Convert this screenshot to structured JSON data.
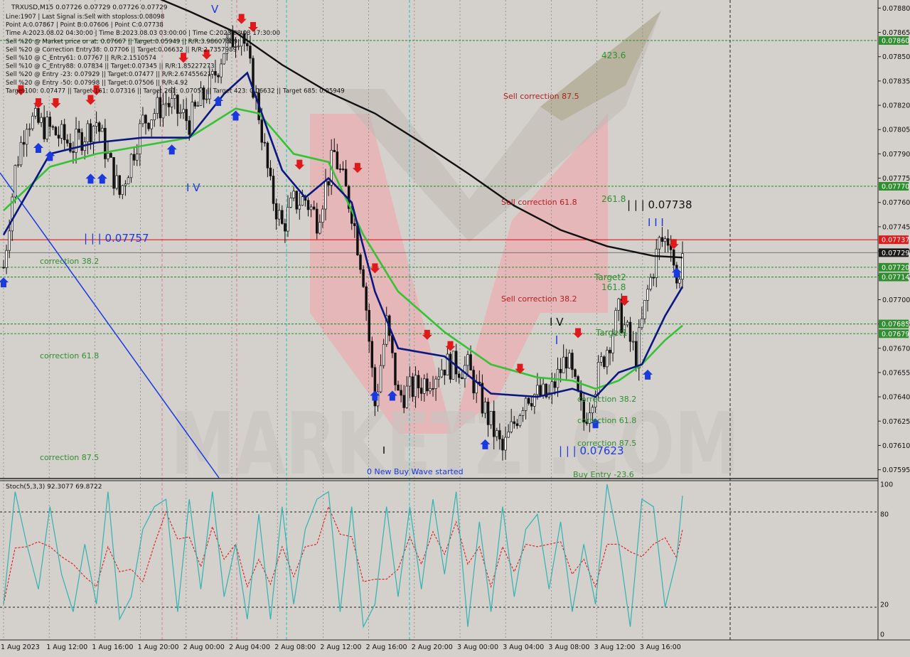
{
  "header": {
    "symbol_line": "TRXUSD,M15  0.07726 0.07729 0.07726 0.07729",
    "info_lines": [
      "Line:1907 | Last Signal is:Sell with stoploss:0.08098",
      "Point A:0.07867 | Point B:0.07606 | Point C:0.07738",
      "Time A:2023.08.02 04:30:00 | Time B:2023.08.03 03:00:00 | Time C:2023.08.03 17:30:00",
      "Sell %20 @ Market price or at: 0.07667 || Target:0.05949 || R/R:3.98607889",
      "Sell %20 @ Correction Entry38: 0.07706 || Target:0.06632 || R/R:2.7357989",
      "Sell %10 @ C_Entry61: 0.07767 || R/R:2.1510574",
      "Sell %10 @ C_Entry88: 0.07834 || Target:0.07345 || R/R:1.85227273",
      "Sell %20 @ Entry -23: 0.07929 || Target:0.07477 || R/R:2.67455621",
      "Sell %20 @ Entry -50: 0.07998 || Target:0.07506 || R/R:4.92",
      "Target100: 0.07477 || Target 161: 0.07316 || Target 261: 0.07055 || Target 423: 0.06632 || Target 685: 0.05949"
    ]
  },
  "annotations": {
    "fib_423": "423.6",
    "fib_261": "261.8",
    "fib_161": "161.8",
    "target2": "Target2",
    "target1": "Target1",
    "sell_corr_875": "Sell correction 87.5",
    "sell_corr_618": "Sell correction 61.8",
    "sell_corr_382": "Sell correction 38.2",
    "corr_382_left": "correction 38.2",
    "corr_618_left": "correction 61.8",
    "corr_875_left": "correction 87.5",
    "corr_382_right": "correction 38.2",
    "corr_618_right": "correction 61.8",
    "corr_875_right": "correction 87.5",
    "buy_entry": "Buy Entry -23.6",
    "new_buy_wave": "0 New Buy Wave started",
    "wave_label_07757": "| | | 0.07757",
    "wave_label_07738": "| | | 0.07738",
    "wave_label_07623": "| | | 0.07623",
    "wave_v": "V",
    "wave_iv_left": "I V",
    "wave_iv_right": "I V",
    "wave_iii": "I I I",
    "watermark": "MARKETZI.COM"
  },
  "price_axis": {
    "ticks": [
      "0.07880",
      "0.07865",
      "0.07850",
      "0.07835",
      "0.07820",
      "0.07805",
      "0.07790",
      "0.07775",
      "0.07760",
      "0.07745",
      "0.07730",
      "0.07715",
      "0.07700",
      "0.07685",
      "0.07670",
      "0.07655",
      "0.07640",
      "0.07625",
      "0.07610",
      "0.07595"
    ],
    "badges": [
      {
        "text": "0.07860",
        "color": "#2f8f2f"
      },
      {
        "text": "0.07770",
        "color": "#2f8f2f"
      },
      {
        "text": "0.07737",
        "color": "#e01a1a"
      },
      {
        "text": "0.07729",
        "color": "#1a1a1a"
      },
      {
        "text": "0.07720",
        "color": "#2f8f2f"
      },
      {
        "text": "0.07714",
        "color": "#2f8f2f"
      },
      {
        "text": "0.07685",
        "color": "#2f8f2f"
      },
      {
        "text": "0.07679",
        "color": "#2f8f2f"
      }
    ]
  },
  "time_axis": {
    "labels": [
      "1 Aug 2023",
      "1 Aug 12:00",
      "1 Aug 16:00",
      "1 Aug 20:00",
      "2 Aug 00:00",
      "2 Aug 04:00",
      "2 Aug 08:00",
      "2 Aug 12:00",
      "2 Aug 16:00",
      "2 Aug 20:00",
      "3 Aug 00:00",
      "3 Aug 04:00",
      "3 Aug 08:00",
      "3 Aug 12:00",
      "3 Aug 16:00"
    ]
  },
  "stoch": {
    "title": "Stoch(5,3,3) 92.3077 69.8722",
    "levels": [
      "100",
      "80",
      "20",
      "0"
    ],
    "main": 92.3077,
    "signal": 69.8722
  },
  "colors": {
    "background": "#d4d0cb",
    "grid": "#8a8a8a",
    "level_green": "#2f8f2f",
    "ema_green": "#35c235",
    "ema_navy": "#0b1780",
    "ma_black": "#111111",
    "sell_arrow": "#e01a1a",
    "buy_arrow": "#1a3ae0",
    "resistance_red": "#e01a1a",
    "watermark_pink": "#e8b3b6"
  },
  "chart_data": {
    "type": "candlestick",
    "title": "TRXUSD,M15",
    "ylim": [
      0.0759,
      0.07885
    ],
    "price_levels": {
      "fib_423_6": 0.0786,
      "fib_261_8": 0.0777,
      "point_c_resistance": 0.07737,
      "current_price": 0.07729,
      "target2": 0.0772,
      "fib_161_8": 0.07714,
      "target1": 0.07685,
      "target1_low": 0.07679
    },
    "points": {
      "A": {
        "time": "2023.08.02 04:30:00",
        "price": 0.07867
      },
      "B": {
        "time": "2023.08.03 03:00:00",
        "price": 0.07606
      },
      "C": {
        "time": "2023.08.03 17:30:00",
        "price": 0.07738
      }
    },
    "close_path": [
      {
        "t": "1 Aug 08:00",
        "p": 0.0772
      },
      {
        "t": "1 Aug 09:00",
        "p": 0.0778
      },
      {
        "t": "1 Aug 10:00",
        "p": 0.07812
      },
      {
        "t": "1 Aug 12:00",
        "p": 0.07805
      },
      {
        "t": "1 Aug 14:00",
        "p": 0.07795
      },
      {
        "t": "1 Aug 16:00",
        "p": 0.0781
      },
      {
        "t": "1 Aug 18:00",
        "p": 0.07765
      },
      {
        "t": "1 Aug 20:00",
        "p": 0.0781
      },
      {
        "t": "1 Aug 22:00",
        "p": 0.07822
      },
      {
        "t": "2 Aug 00:00",
        "p": 0.0781
      },
      {
        "t": "2 Aug 02:00",
        "p": 0.07835
      },
      {
        "t": "2 Aug 03:00",
        "p": 0.07855
      },
      {
        "t": "2 Aug 04:30",
        "p": 0.07867
      },
      {
        "t": "2 Aug 06:00",
        "p": 0.07815
      },
      {
        "t": "2 Aug 07:00",
        "p": 0.07768
      },
      {
        "t": "2 Aug 08:00",
        "p": 0.07745
      },
      {
        "t": "2 Aug 09:00",
        "p": 0.0776
      },
      {
        "t": "2 Aug 10:00",
        "p": 0.07762
      },
      {
        "t": "2 Aug 11:00",
        "p": 0.0775
      },
      {
        "t": "2 Aug 12:30",
        "p": 0.0779
      },
      {
        "t": "2 Aug 14:00",
        "p": 0.07755
      },
      {
        "t": "2 Aug 15:00",
        "p": 0.07715
      },
      {
        "t": "2 Aug 16:00",
        "p": 0.07635
      },
      {
        "t": "2 Aug 17:00",
        "p": 0.07685
      },
      {
        "t": "2 Aug 18:00",
        "p": 0.0764
      },
      {
        "t": "2 Aug 20:00",
        "p": 0.07648
      },
      {
        "t": "2 Aug 22:00",
        "p": 0.0766
      },
      {
        "t": "3 Aug 00:00",
        "p": 0.07658
      },
      {
        "t": "3 Aug 01:00",
        "p": 0.0764
      },
      {
        "t": "3 Aug 03:00",
        "p": 0.07606
      },
      {
        "t": "3 Aug 05:00",
        "p": 0.07642
      },
      {
        "t": "3 Aug 07:00",
        "p": 0.0764
      },
      {
        "t": "3 Aug 08:30",
        "p": 0.07665
      },
      {
        "t": "3 Aug 10:00",
        "p": 0.07625
      },
      {
        "t": "3 Aug 11:30",
        "p": 0.0766
      },
      {
        "t": "3 Aug 13:00",
        "p": 0.07692
      },
      {
        "t": "3 Aug 14:30",
        "p": 0.07665
      },
      {
        "t": "3 Aug 15:30",
        "p": 0.07705
      },
      {
        "t": "3 Aug 16:30",
        "p": 0.07735
      },
      {
        "t": "3 Aug 17:30",
        "p": 0.07738
      },
      {
        "t": "3 Aug 18:00",
        "p": 0.07708
      },
      {
        "t": "3 Aug 18:30",
        "p": 0.07729
      }
    ],
    "ema_fast": [
      {
        "t": "1 Aug 08:00",
        "p": 0.0774
      },
      {
        "t": "1 Aug 12:00",
        "p": 0.0779
      },
      {
        "t": "1 Aug 16:00",
        "p": 0.07797
      },
      {
        "t": "1 Aug 20:00",
        "p": 0.078
      },
      {
        "t": "2 Aug 00:00",
        "p": 0.078
      },
      {
        "t": "2 Aug 03:00",
        "p": 0.07827
      },
      {
        "t": "2 Aug 05:00",
        "p": 0.0784
      },
      {
        "t": "2 Aug 08:00",
        "p": 0.0778
      },
      {
        "t": "2 Aug 10:00",
        "p": 0.07763
      },
      {
        "t": "2 Aug 12:00",
        "p": 0.07775
      },
      {
        "t": "2 Aug 14:00",
        "p": 0.0776
      },
      {
        "t": "2 Aug 16:00",
        "p": 0.07705
      },
      {
        "t": "2 Aug 18:00",
        "p": 0.0767
      },
      {
        "t": "2 Aug 22:00",
        "p": 0.07665
      },
      {
        "t": "3 Aug 02:00",
        "p": 0.07642
      },
      {
        "t": "3 Aug 06:00",
        "p": 0.0764
      },
      {
        "t": "3 Aug 09:00",
        "p": 0.07645
      },
      {
        "t": "3 Aug 11:00",
        "p": 0.0764
      },
      {
        "t": "3 Aug 13:00",
        "p": 0.07655
      },
      {
        "t": "3 Aug 15:00",
        "p": 0.0766
      },
      {
        "t": "3 Aug 17:00",
        "p": 0.0769
      },
      {
        "t": "3 Aug 18:30",
        "p": 0.07708
      }
    ],
    "ema_slow": [
      {
        "t": "1 Aug 08:00",
        "p": 0.07755
      },
      {
        "t": "1 Aug 12:00",
        "p": 0.07782
      },
      {
        "t": "1 Aug 16:00",
        "p": 0.0779
      },
      {
        "t": "1 Aug 20:00",
        "p": 0.07795
      },
      {
        "t": "2 Aug 00:00",
        "p": 0.078
      },
      {
        "t": "2 Aug 04:00",
        "p": 0.07818
      },
      {
        "t": "2 Aug 06:00",
        "p": 0.07815
      },
      {
        "t": "2 Aug 09:00",
        "p": 0.0779
      },
      {
        "t": "2 Aug 12:00",
        "p": 0.07785
      },
      {
        "t": "2 Aug 15:00",
        "p": 0.0774
      },
      {
        "t": "2 Aug 18:00",
        "p": 0.07705
      },
      {
        "t": "2 Aug 22:00",
        "p": 0.0768
      },
      {
        "t": "3 Aug 02:00",
        "p": 0.0766
      },
      {
        "t": "3 Aug 06:00",
        "p": 0.07652
      },
      {
        "t": "3 Aug 09:00",
        "p": 0.0765
      },
      {
        "t": "3 Aug 11:00",
        "p": 0.07645
      },
      {
        "t": "3 Aug 13:00",
        "p": 0.0765
      },
      {
        "t": "3 Aug 15:00",
        "p": 0.0766
      },
      {
        "t": "3 Aug 17:00",
        "p": 0.07675
      },
      {
        "t": "3 Aug 18:30",
        "p": 0.07684
      }
    ],
    "ma_long": [
      {
        "t": "1 Aug 20:00",
        "p": 0.0789
      },
      {
        "t": "2 Aug 00:00",
        "p": 0.07878
      },
      {
        "t": "2 Aug 04:00",
        "p": 0.07865
      },
      {
        "t": "2 Aug 08:00",
        "p": 0.07845
      },
      {
        "t": "2 Aug 12:00",
        "p": 0.07828
      },
      {
        "t": "2 Aug 16:00",
        "p": 0.07815
      },
      {
        "t": "2 Aug 20:00",
        "p": 0.07797
      },
      {
        "t": "3 Aug 00:00",
        "p": 0.07778
      },
      {
        "t": "3 Aug 04:00",
        "p": 0.07758
      },
      {
        "t": "3 Aug 08:00",
        "p": 0.07743
      },
      {
        "t": "3 Aug 12:00",
        "p": 0.07733
      },
      {
        "t": "3 Aug 16:00",
        "p": 0.07727
      },
      {
        "t": "3 Aug 18:30",
        "p": 0.07726
      }
    ],
    "stoch_main": [
      {
        "t": "1 Aug 08:00",
        "v": 20
      },
      {
        "t": "1 Aug 09:00",
        "v": 95
      },
      {
        "t": "1 Aug 10:00",
        "v": 60
      },
      {
        "t": "1 Aug 11:00",
        "v": 30
      },
      {
        "t": "1 Aug 12:00",
        "v": 85
      },
      {
        "t": "1 Aug 13:00",
        "v": 40
      },
      {
        "t": "1 Aug 14:00",
        "v": 15
      },
      {
        "t": "1 Aug 15:00",
        "v": 60
      },
      {
        "t": "1 Aug 16:00",
        "v": 20
      },
      {
        "t": "1 Aug 17:00",
        "v": 95
      },
      {
        "t": "1 Aug 18:00",
        "v": 10
      },
      {
        "t": "1 Aug 19:00",
        "v": 25
      },
      {
        "t": "1 Aug 20:00",
        "v": 70
      },
      {
        "t": "1 Aug 21:00",
        "v": 85
      },
      {
        "t": "1 Aug 22:00",
        "v": 90
      },
      {
        "t": "1 Aug 23:00",
        "v": 15
      },
      {
        "t": "2 Aug 00:00",
        "v": 90
      },
      {
        "t": "2 Aug 01:00",
        "v": 30
      },
      {
        "t": "2 Aug 02:00",
        "v": 95
      },
      {
        "t": "2 Aug 03:00",
        "v": 25
      },
      {
        "t": "2 Aug 04:00",
        "v": 60
      },
      {
        "t": "2 Aug 05:00",
        "v": 10
      },
      {
        "t": "2 Aug 06:00",
        "v": 80
      },
      {
        "t": "2 Aug 07:00",
        "v": 10
      },
      {
        "t": "2 Aug 08:00",
        "v": 85
      },
      {
        "t": "2 Aug 09:00",
        "v": 20
      },
      {
        "t": "2 Aug 10:00",
        "v": 70
      },
      {
        "t": "2 Aug 11:00",
        "v": 90
      },
      {
        "t": "2 Aug 12:00",
        "v": 95
      },
      {
        "t": "2 Aug 13:00",
        "v": 15
      },
      {
        "t": "2 Aug 14:00",
        "v": 85
      },
      {
        "t": "2 Aug 15:00",
        "v": 5
      },
      {
        "t": "2 Aug 16:00",
        "v": 20
      },
      {
        "t": "2 Aug 17:00",
        "v": 85
      },
      {
        "t": "2 Aug 18:00",
        "v": 25
      },
      {
        "t": "2 Aug 19:00",
        "v": 85
      },
      {
        "t": "2 Aug 20:00",
        "v": 30
      },
      {
        "t": "2 Aug 21:00",
        "v": 90
      },
      {
        "t": "2 Aug 22:00",
        "v": 40
      },
      {
        "t": "2 Aug 23:00",
        "v": 95
      },
      {
        "t": "3 Aug 00:00",
        "v": 5
      },
      {
        "t": "3 Aug 01:00",
        "v": 75
      },
      {
        "t": "3 Aug 02:00",
        "v": 15
      },
      {
        "t": "3 Aug 03:00",
        "v": 85
      },
      {
        "t": "3 Aug 04:00",
        "v": 25
      },
      {
        "t": "3 Aug 05:00",
        "v": 70
      },
      {
        "t": "3 Aug 06:00",
        "v": 80
      },
      {
        "t": "3 Aug 07:00",
        "v": 30
      },
      {
        "t": "3 Aug 08:00",
        "v": 75
      },
      {
        "t": "3 Aug 09:00",
        "v": 15
      },
      {
        "t": "3 Aug 10:00",
        "v": 60
      },
      {
        "t": "3 Aug 11:00",
        "v": 20
      },
      {
        "t": "3 Aug 12:00",
        "v": 100
      },
      {
        "t": "3 Aug 13:00",
        "v": 60
      },
      {
        "t": "3 Aug 14:00",
        "v": 5
      },
      {
        "t": "3 Aug 15:00",
        "v": 90
      },
      {
        "t": "3 Aug 16:00",
        "v": 85
      },
      {
        "t": "3 Aug 17:00",
        "v": 18
      },
      {
        "t": "3 Aug 18:00",
        "v": 50
      },
      {
        "t": "3 Aug 18:30",
        "v": 92.3
      }
    ]
  }
}
